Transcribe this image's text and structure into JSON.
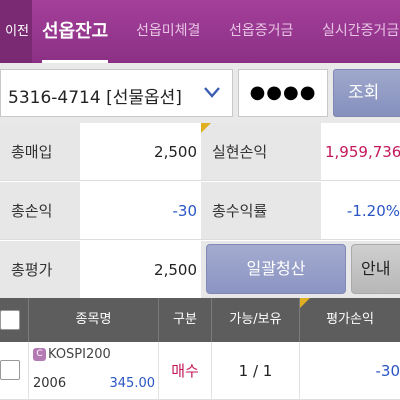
{
  "tabs": {
    "prev_label": "이전",
    "items": [
      {
        "label": "선옵잔고",
        "active": true
      },
      {
        "label": "선옵미체결",
        "active": false
      },
      {
        "label": "선옵증거금",
        "active": false
      },
      {
        "label": "실시간증거금",
        "active": false
      }
    ]
  },
  "account": {
    "selected": "5316-4714 [선물옵션]",
    "password_mask": "●●●●",
    "search_label": "조회"
  },
  "summary": {
    "total_buy_label": "총매입",
    "total_buy_value": "2,500",
    "realized_pl_label": "실현손익",
    "realized_pl_value": "1,959,736",
    "total_pl_label": "총손익",
    "total_pl_value": "-30",
    "total_return_label": "총수익률",
    "total_return_value": "-1.20%",
    "total_eval_label": "총평가",
    "total_eval_value": "2,500",
    "bulk_close_label": "일괄청산",
    "guide_label": "안내"
  },
  "table": {
    "headers": [
      "종목명",
      "구분",
      "가능/보유",
      "평가손익"
    ],
    "rows": [
      {
        "badge": "C",
        "name": "KOSPI200",
        "code": "2006",
        "price": "345.00",
        "side": "매수",
        "qty": "1 / 1",
        "pl": "-30"
      }
    ]
  },
  "colors": {
    "brand_purple": "#9a3891",
    "positive_red": "#c2185b",
    "negative_blue": "#2a55c4",
    "header_gray": "#5d5d5d"
  }
}
